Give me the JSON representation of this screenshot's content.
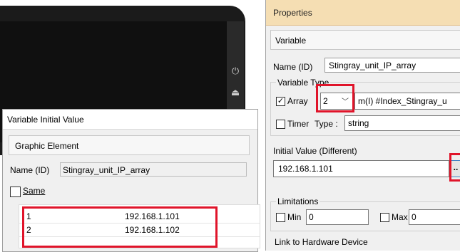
{
  "device": {
    "icons": [
      "power-icon",
      "eject-icon"
    ]
  },
  "initial_value_dialog": {
    "title": "Variable Initial Value",
    "group_label": "Graphic Element",
    "name_label": "Name (ID)",
    "name_value": "Stingray_unit_IP_array",
    "same_label": "Same",
    "same_checked": false,
    "rows": [
      {
        "index": "1",
        "value": "192.168.1.101"
      },
      {
        "index": "2",
        "value": "192.168.1.102"
      }
    ]
  },
  "properties": {
    "title": "Properties",
    "section_label": "Variable",
    "name_label": "Name (ID)",
    "name_value": "Stingray_unit_IP_array",
    "variable_type_label": "Variable Type",
    "array_label": "Array",
    "array_checked": true,
    "array_size": "2",
    "index_value": "m(I) #Index_Stingray_u",
    "timer_label": "Timer",
    "timer_checked": false,
    "type_label": "Type :",
    "type_value": "string",
    "initial_value_label": "Initial Value (Different)",
    "initial_value": "192.168.1.101",
    "initial_value_button": "..",
    "limitations_label": "Limitations",
    "min_label": "Min",
    "min_value": "0",
    "max_label": "Max",
    "max_value": "0",
    "link_label": "Link to Hardware Device"
  },
  "colors": {
    "highlight": "#e0142a",
    "title_bar": "#f5deb3"
  }
}
